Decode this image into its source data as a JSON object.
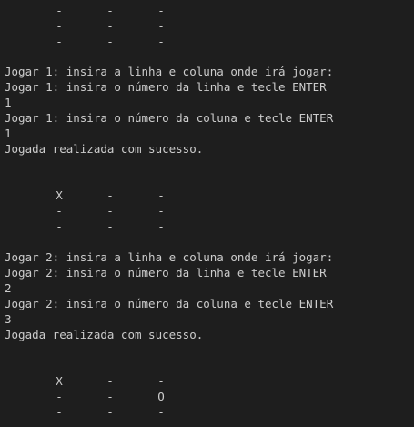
{
  "terminal": {
    "background": "#1e1e1e",
    "foreground": "#cccccc",
    "boards": [
      {
        "rows": [
          [
            "-",
            "-",
            "-"
          ],
          [
            "-",
            "-",
            "-"
          ],
          [
            "-",
            "-",
            "-"
          ]
        ]
      },
      {
        "rows": [
          [
            "X",
            "-",
            "-"
          ],
          [
            "-",
            "-",
            "-"
          ],
          [
            "-",
            "-",
            "-"
          ]
        ]
      },
      {
        "rows": [
          [
            "X",
            "-",
            "-"
          ],
          [
            "-",
            "-",
            "O"
          ],
          [
            "-",
            "-",
            "-"
          ]
        ]
      }
    ],
    "turns": [
      {
        "lines": [
          "Jogar 1: insira a linha e coluna onde irá jogar:",
          "Jogar 1: insira o número da linha e tecle ENTER",
          "1",
          "Jogar 1: insira o número da coluna e tecle ENTER",
          "1",
          "Jogada realizada com sucesso."
        ]
      },
      {
        "lines": [
          "Jogar 2: insira a linha e coluna onde irá jogar:",
          "Jogar 2: insira o número da linha e tecle ENTER",
          "2",
          "Jogar 2: insira o número da coluna e tecle ENTER",
          "3",
          "Jogada realizada com sucesso."
        ]
      }
    ]
  }
}
